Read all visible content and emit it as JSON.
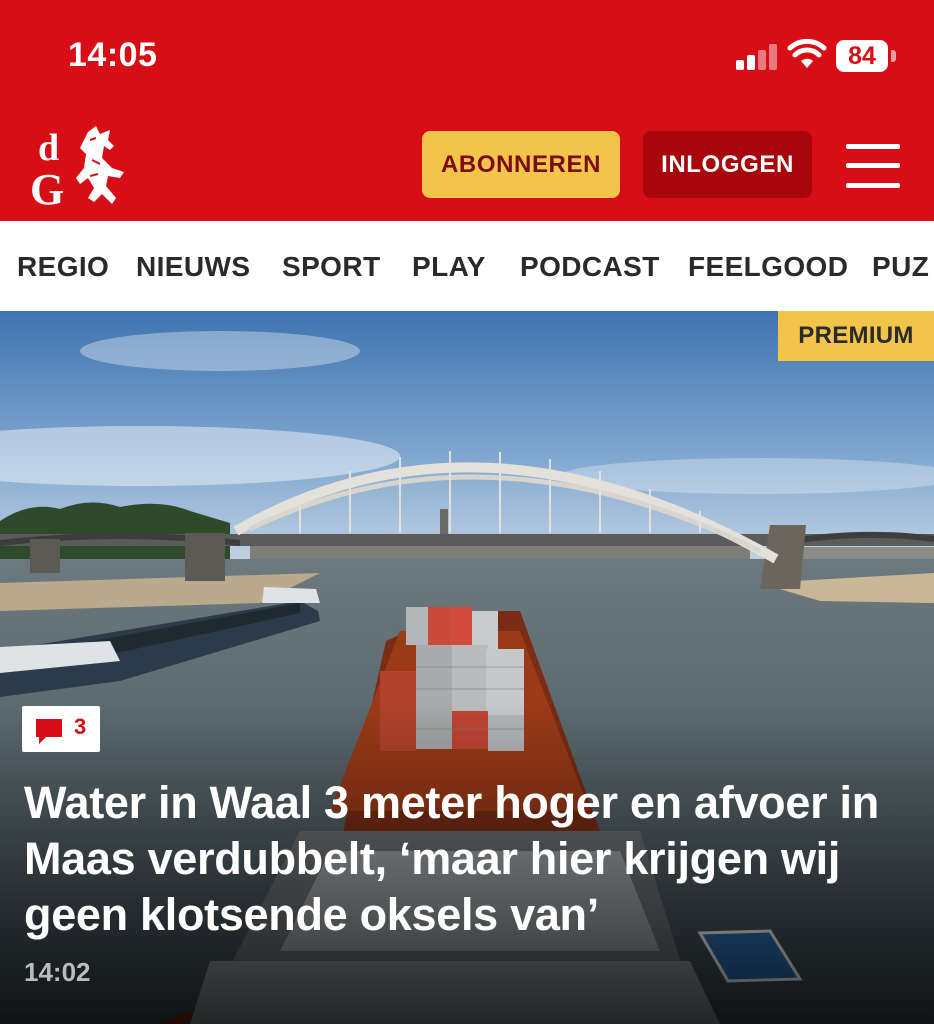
{
  "status_bar": {
    "time": "14:05",
    "battery": "84"
  },
  "header": {
    "logo_text": "dG",
    "subscribe_label": "ABONNEREN",
    "login_label": "INLOGGEN"
  },
  "nav": {
    "items": [
      "REGIO",
      "NIEUWS",
      "SPORT",
      "PLAY",
      "PODCAST",
      "FEELGOOD",
      "PUZ"
    ]
  },
  "hero": {
    "premium_label": "PREMIUM",
    "comment_count": "3",
    "headline": "Water in Waal 3 meter hoger en afvoer in Maas verdubbelt, ‘maar hier krijgen wij geen klotsende oksels van’",
    "time": "14:02"
  },
  "colors": {
    "brand_red": "#d80e16",
    "dark_red": "#a8060c",
    "accent_yellow": "#f3c44a"
  },
  "icons": [
    "signal-icon",
    "wifi-icon",
    "battery-icon",
    "hamburger-menu-icon",
    "comment-icon"
  ]
}
